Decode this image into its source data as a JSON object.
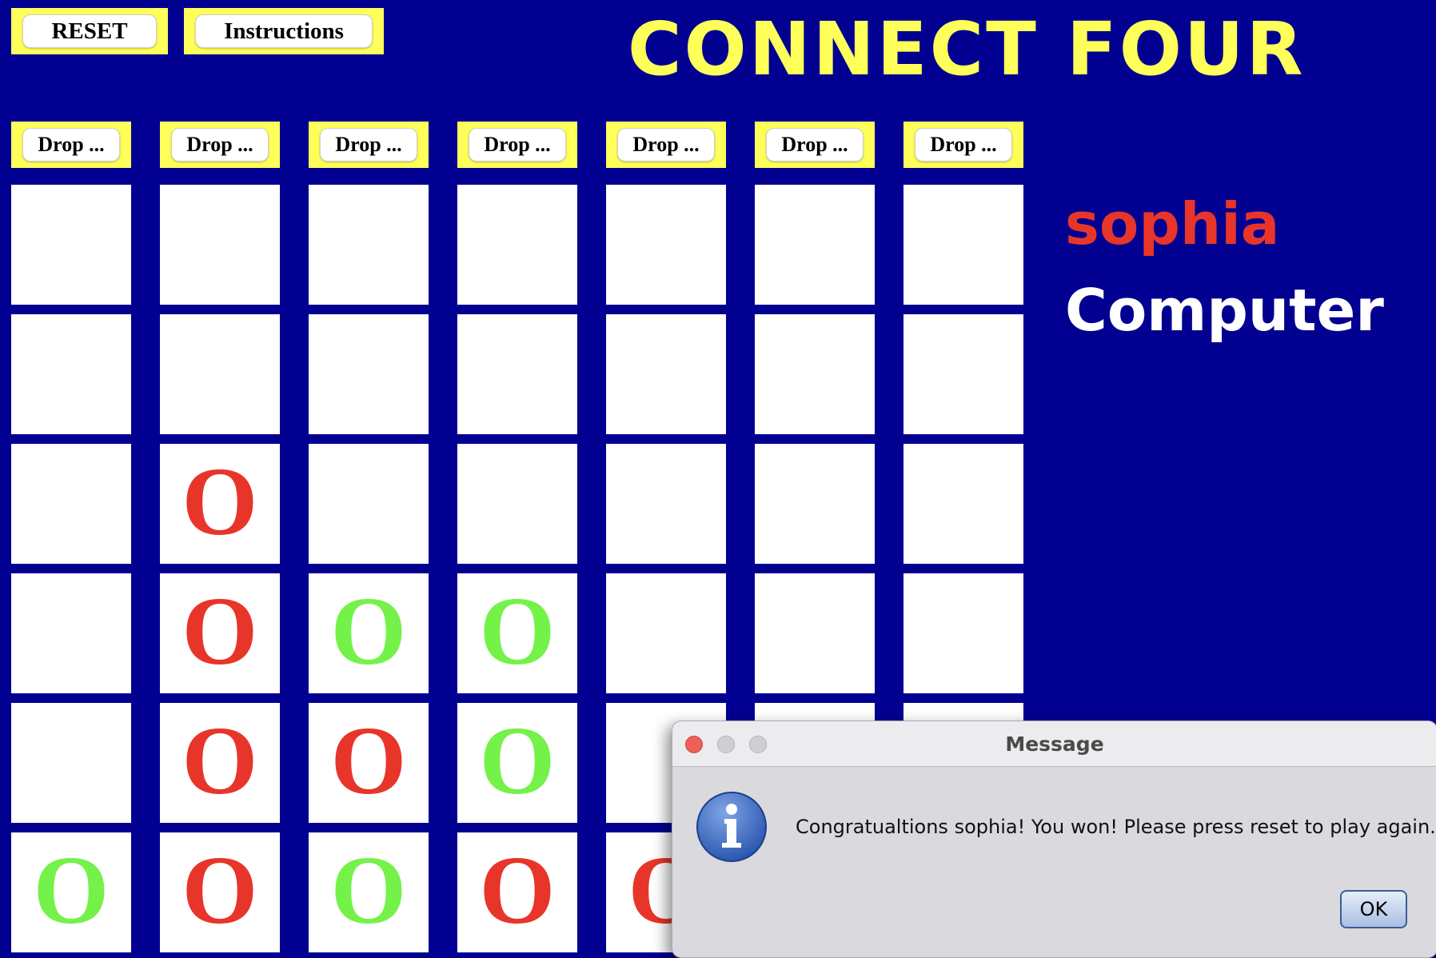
{
  "title": "CONNECT FOUR",
  "toolbar": {
    "reset_label": "RESET",
    "instructions_label": "Instructions"
  },
  "drop_buttons": [
    "Drop ...",
    "Drop ...",
    "Drop ...",
    "Drop ...",
    "Drop ...",
    "Drop ...",
    "Drop ..."
  ],
  "board": [
    [
      "",
      "",
      "",
      "",
      "",
      "",
      ""
    ],
    [
      "",
      "",
      "",
      "",
      "",
      "",
      ""
    ],
    [
      "",
      "O",
      "",
      "",
      "",
      "",
      ""
    ],
    [
      "",
      "O",
      "O",
      "O",
      "",
      "",
      ""
    ],
    [
      "",
      "O",
      "O",
      "O",
      "",
      "",
      ""
    ],
    [
      "O",
      "O",
      "O",
      "O",
      "O",
      "",
      ""
    ]
  ],
  "board_colors": [
    [
      "",
      "",
      "",
      "",
      "",
      "",
      ""
    ],
    [
      "",
      "",
      "",
      "",
      "",
      "",
      ""
    ],
    [
      "",
      "red",
      "",
      "",
      "",
      "",
      ""
    ],
    [
      "",
      "red",
      "green",
      "green",
      "",
      "",
      ""
    ],
    [
      "",
      "red",
      "red",
      "green",
      "",
      "",
      ""
    ],
    [
      "green",
      "red",
      "green",
      "red",
      "red",
      "",
      ""
    ]
  ],
  "colors": {
    "red": "#e8352a",
    "green": "#75f24a",
    "background": "#020090",
    "accent": "#ffff5a"
  },
  "players": {
    "player1": "sophia",
    "player2": "Computer"
  },
  "dialog": {
    "title": "Message",
    "icon": "info-icon",
    "message": "Congratualtions sophia! You won! Please press reset to play again.",
    "ok_label": "OK"
  }
}
